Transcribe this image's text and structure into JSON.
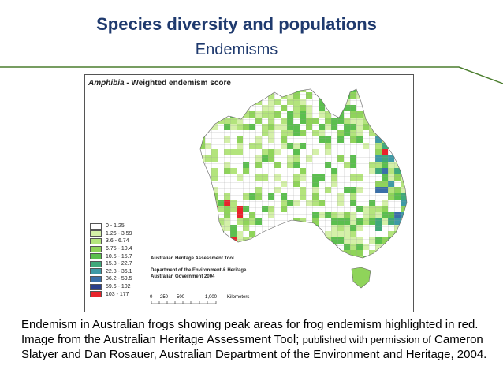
{
  "slide": {
    "title": "Species diversity and populations",
    "subtitle": "Endemisms",
    "colors": {
      "title": "#1f3a6e",
      "rule": "#4a7d2d"
    }
  },
  "map": {
    "title_italic": "Amphibia",
    "title_rest": " - Weighted endemism score",
    "legend": [
      {
        "label": "0 - 1.25",
        "color": "#ffffff"
      },
      {
        "label": "1.26 - 3.59",
        "color": "#d4f0a8"
      },
      {
        "label": "3.6 - 6.74",
        "color": "#b3e47c"
      },
      {
        "label": "6.75 - 10.4",
        "color": "#8fd45a"
      },
      {
        "label": "10.5 - 15.7",
        "color": "#5bbf4e"
      },
      {
        "label": "15.8 - 22.7",
        "color": "#3fa97a"
      },
      {
        "label": "22.8 - 36.1",
        "color": "#3d9aa6"
      },
      {
        "label": "36.2 - 59.5",
        "color": "#3a6fa8"
      },
      {
        "label": "59.6 - 102",
        "color": "#2a3f8c"
      },
      {
        "label": "103 - 177",
        "color": "#e8232b"
      }
    ],
    "credit_tool": "Australian Heritage Assessment Tool",
    "credit_dept": "Department of the Environment & Heritage",
    "credit_gov": "Australian Government 2004",
    "scale_labels": [
      "0",
      "250",
      "500",
      "1,000",
      "Kilometers"
    ]
  },
  "caption": {
    "main": "Endemism in Australian frogs showing peak areas for frog endemism highlighted in red. Image from the Australian Heritage Assessment Tool; ",
    "small": "published with permission of",
    "rest": " Cameron Slatyer and Dan Rosauer, Australian Department of the Environment and Heritage, 2004."
  }
}
